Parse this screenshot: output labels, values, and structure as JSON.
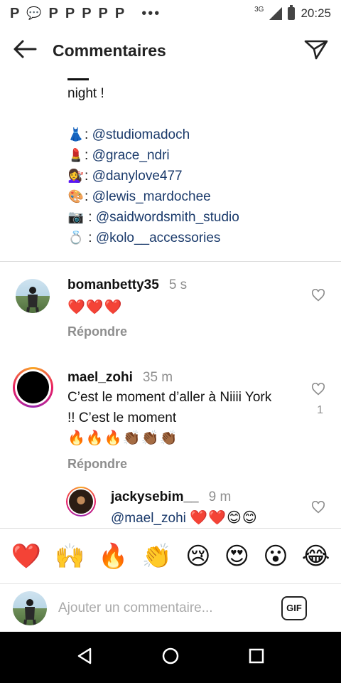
{
  "status_bar": {
    "notification_icons": [
      "P",
      "💬",
      "P",
      "P",
      "P",
      "P",
      "P"
    ],
    "network": "3G",
    "time": "20:25"
  },
  "header": {
    "title": "Commentaires"
  },
  "caption": {
    "first_line": "night !",
    "credits": [
      {
        "emoji": "👗",
        "sep": ":",
        "tag": "@studiomadoch"
      },
      {
        "emoji": "💄",
        "sep": ":",
        "tag": "@grace_ndri"
      },
      {
        "emoji": "💇‍♀️",
        "sep": ":",
        "tag": "@danylove477"
      },
      {
        "emoji": "🎨",
        "sep": ":",
        "tag": "@lewis_mardochee"
      },
      {
        "emoji": "📷",
        "sep": ":",
        "tag": "@saidwordsmith_studio"
      },
      {
        "emoji": "💍",
        "sep": ":",
        "tag": "@kolo__accessories"
      }
    ]
  },
  "comments": [
    {
      "username": "bomanbetty35",
      "time": "5 s",
      "text": "❤️❤️❤️",
      "reply_label": "Répondre"
    },
    {
      "username": "mael_zohi",
      "time": "35 m",
      "text_line1": "C’est le moment d’aller à Niiii York",
      "text_line2": "!! C’est le moment",
      "emojis": "🔥🔥🔥👏🏾👏🏾👏🏾",
      "reply_label": "Répondre",
      "likes": "1"
    },
    {
      "username": "jackysebim__",
      "time": "9 m",
      "mention": "@mael_zohi",
      "emojis": "❤️❤️😊😊"
    }
  ],
  "quick_emojis": [
    "❤️",
    "🙌",
    "🔥",
    "👏",
    "😢",
    "😍",
    "😮",
    "😂"
  ],
  "input": {
    "placeholder": "Ajouter un commentaire...",
    "gif_label": "GIF"
  }
}
